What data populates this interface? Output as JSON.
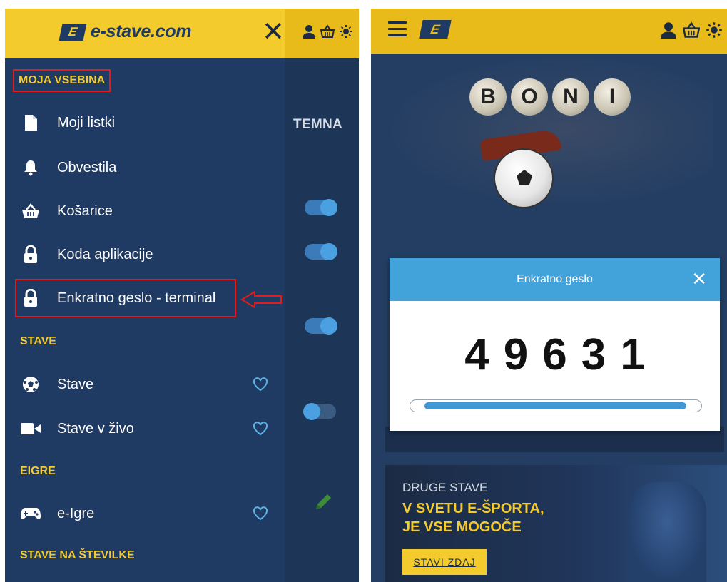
{
  "left": {
    "brand": "e-stave.com",
    "brand_mark": "E",
    "close_symbol": "✕",
    "behind": {
      "temna_label": "TEMNA"
    },
    "sections": {
      "moja": "MOJA VSEBINA",
      "stave": "STAVE",
      "eigre": "EIGRE",
      "stevilke": "STAVE NA ŠTEVILKE"
    },
    "items": [
      {
        "label": "Moji listki",
        "icon": "document-icon"
      },
      {
        "label": "Obvestila",
        "icon": "bell-icon"
      },
      {
        "label": "Košarice",
        "icon": "basket-icon"
      },
      {
        "label": "Koda aplikacije",
        "icon": "lock-icon"
      },
      {
        "label": "Enkratno geslo - terminal",
        "icon": "lock-icon"
      },
      {
        "label": "Stave",
        "icon": "soccer-ball-icon"
      },
      {
        "label": "Stave v živo",
        "icon": "video-camera-icon"
      },
      {
        "label": "e-Igre",
        "icon": "gamepad-icon"
      }
    ]
  },
  "right": {
    "brand_mark": "E",
    "banner_letters": [
      "B",
      "O",
      "N",
      "I"
    ],
    "modal": {
      "title": "Enkratno geslo",
      "close_symbol": "✕",
      "code": "49631",
      "progress": 0.94
    },
    "promo": {
      "subtitle": "DRUGE STAVE",
      "title_line1": "V SVETU E-ŠPORTA,",
      "title_line2": "JE VSE MOGOČE",
      "button": "STAVI ZDAJ"
    }
  },
  "colors": {
    "header_yellow": "#f4cb2c",
    "drawer_blue": "#1f3a63",
    "annotation_red": "#e21b1b",
    "modal_blue": "#42a3db"
  }
}
